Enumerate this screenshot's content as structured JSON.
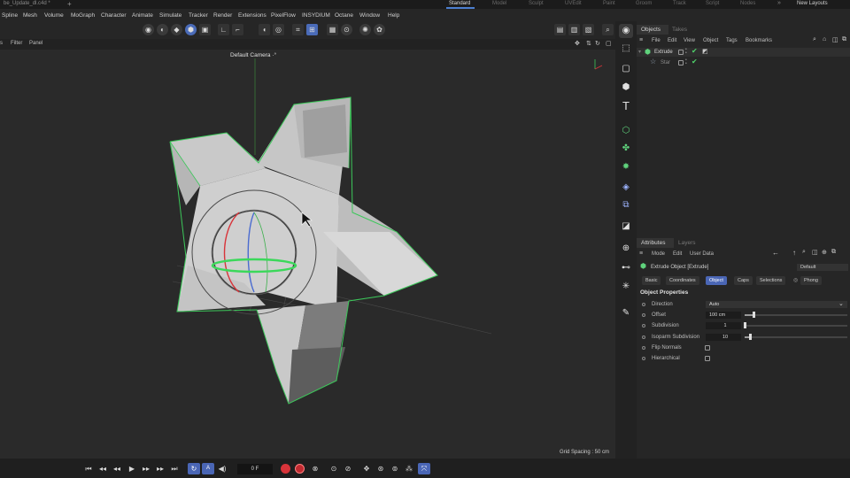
{
  "doc_tab": "be_Update_dl.c4d *",
  "layouts": [
    {
      "label": "Standard",
      "active": true
    },
    {
      "label": "Model"
    },
    {
      "label": "Sculpt"
    },
    {
      "label": "UVEdit"
    },
    {
      "label": "Paint"
    },
    {
      "label": "Groom"
    },
    {
      "label": "Track"
    },
    {
      "label": "Script"
    },
    {
      "label": "Nodes"
    }
  ],
  "new_layouts": "New Layouts",
  "menu": [
    "Spline",
    "Mesh",
    "Volume",
    "MoGraph",
    "Character",
    "Animate",
    "Simulate",
    "Tracker",
    "Render",
    "Extensions",
    "PixelFlow",
    "INSYDIUM",
    "Octane",
    "Window",
    "Help"
  ],
  "viewport_menu": [
    "Filter",
    "Panel"
  ],
  "camera_label": "Default Camera ·°",
  "grid_spacing": "Grid Spacing : 50 cm",
  "objects_panel": {
    "tabs": [
      "Objects",
      "Takes"
    ],
    "menu": [
      "File",
      "Edit",
      "View",
      "Object",
      "Tags",
      "Bookmarks"
    ],
    "rows": [
      {
        "name": "Extrude",
        "type_icon": "extrude-icon"
      },
      {
        "name": "Star",
        "type_icon": "star-icon"
      }
    ]
  },
  "attributes_panel": {
    "tabs": [
      "Attributes",
      "Layers"
    ],
    "menu": [
      "Mode",
      "Edit",
      "User Data"
    ],
    "object_title": "Extrude Object [Extrude]",
    "preset": "Default",
    "sub_tabs": [
      {
        "label": "Basic"
      },
      {
        "label": "Coordinates"
      },
      {
        "label": "Object",
        "active": true
      },
      {
        "label": "Caps"
      },
      {
        "label": "Selections"
      },
      {
        "label": "Phong"
      }
    ],
    "section": "Object Properties",
    "properties": [
      {
        "label": "Direction",
        "value": "Auto"
      },
      {
        "label": "Offset",
        "value": "100 cm"
      },
      {
        "label": "Subdivision",
        "value": "1"
      },
      {
        "label": "Isoparm Subdivision",
        "value": "10"
      },
      {
        "label": "Flip Normals",
        "value": ""
      },
      {
        "label": "Hierarchical",
        "value": ""
      }
    ]
  },
  "timeline": {
    "frame": "0 F"
  },
  "colors": {
    "accent": "#4a66b5",
    "selection_edge": "#3cc85a",
    "check": "#4fd26a"
  }
}
